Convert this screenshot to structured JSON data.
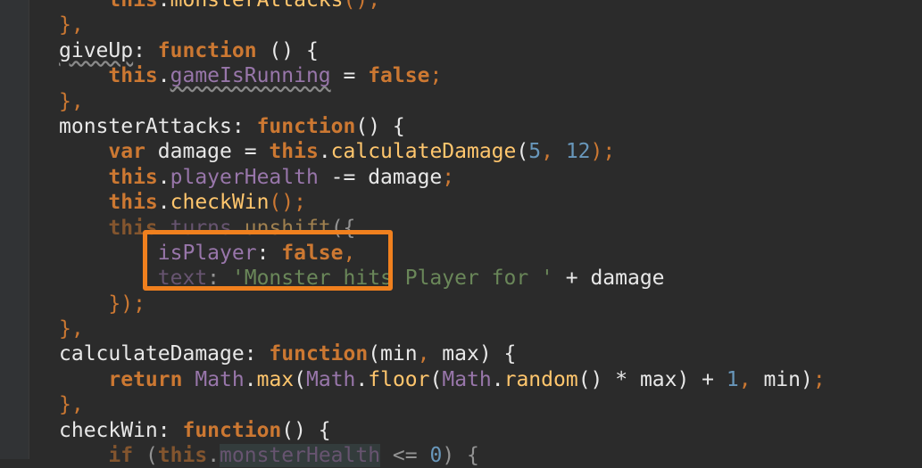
{
  "editor": {
    "lines": [
      [
        {
          "t": "    "
        },
        {
          "t": "this",
          "c": "this"
        },
        {
          "t": "."
        },
        {
          "t": "monsterAttacks",
          "c": "fn"
        },
        {
          "t": "();",
          "c": "punc"
        }
      ],
      [
        {
          "t": "},",
          "c": "punc"
        }
      ],
      [
        {
          "t": "giveUp",
          "c": "squig"
        },
        {
          "t": ": "
        },
        {
          "t": "function",
          "c": "kw"
        },
        {
          "t": " () {"
        }
      ],
      [
        {
          "t": "    "
        },
        {
          "t": "this",
          "c": "this"
        },
        {
          "t": "."
        },
        {
          "t": "gameIsRunning",
          "c": "propsquig"
        },
        {
          "t": " = "
        },
        {
          "t": "false",
          "c": "kw"
        },
        {
          "t": ";",
          "c": "punc"
        }
      ],
      [
        {
          "t": "},",
          "c": "punc"
        }
      ],
      [
        {
          "t": "monsterAttacks"
        },
        {
          "t": ": "
        },
        {
          "t": "function",
          "c": "kw"
        },
        {
          "t": "() {"
        }
      ],
      [
        {
          "t": "    "
        },
        {
          "t": "var",
          "c": "kw"
        },
        {
          "t": " damage = "
        },
        {
          "t": "this",
          "c": "this"
        },
        {
          "t": "."
        },
        {
          "t": "calculateDamage",
          "c": "fn"
        },
        {
          "t": "("
        },
        {
          "t": "5",
          "c": "num"
        },
        {
          "t": ", ",
          "c": "punc"
        },
        {
          "t": "12",
          "c": "num"
        },
        {
          "t": ");",
          "c": "punc"
        }
      ],
      [
        {
          "t": "    "
        },
        {
          "t": "this",
          "c": "this"
        },
        {
          "t": "."
        },
        {
          "t": "playerHealth",
          "c": "prop"
        },
        {
          "t": " -= damage"
        },
        {
          "t": ";",
          "c": "punc"
        }
      ],
      [
        {
          "t": "    "
        },
        {
          "t": "this",
          "c": "this"
        },
        {
          "t": "."
        },
        {
          "t": "checkWin",
          "c": "fn"
        },
        {
          "t": "();",
          "c": "punc"
        }
      ],
      [
        {
          "t": "    "
        },
        {
          "t": "this",
          "c": "thisdim"
        },
        {
          "t": ".",
          "c": "dim"
        },
        {
          "t": "turns",
          "c": "propdim"
        },
        {
          "t": ".",
          "c": "dim"
        },
        {
          "t": "unshift",
          "c": "fndim"
        },
        {
          "t": "({",
          "c": "dim"
        }
      ],
      [
        {
          "t": "        "
        },
        {
          "t": "isPlayer",
          "c": "prop"
        },
        {
          "t": ": "
        },
        {
          "t": "false",
          "c": "kw"
        },
        {
          "t": ",",
          "c": "punc"
        }
      ],
      [
        {
          "t": "        "
        },
        {
          "t": "text",
          "c": "propdim"
        },
        {
          "t": ": ",
          "c": "dim"
        },
        {
          "t": "'Monster hits Player for '",
          "c": "str"
        },
        {
          "t": " + damage"
        }
      ],
      [
        {
          "t": "    "
        },
        {
          "t": "});",
          "c": "punc"
        }
      ],
      [
        {
          "t": "},",
          "c": "punc"
        }
      ],
      [
        {
          "t": "calculateDamage"
        },
        {
          "t": ": "
        },
        {
          "t": "function",
          "c": "kw"
        },
        {
          "t": "(min"
        },
        {
          "t": ", ",
          "c": "punc"
        },
        {
          "t": "max) {"
        }
      ],
      [
        {
          "t": "    "
        },
        {
          "t": "return",
          "c": "kw"
        },
        {
          "t": " "
        },
        {
          "t": "Math",
          "c": "cls"
        },
        {
          "t": "."
        },
        {
          "t": "max",
          "c": "fn"
        },
        {
          "t": "("
        },
        {
          "t": "Math",
          "c": "cls"
        },
        {
          "t": "."
        },
        {
          "t": "floor",
          "c": "fn"
        },
        {
          "t": "("
        },
        {
          "t": "Math",
          "c": "cls"
        },
        {
          "t": "."
        },
        {
          "t": "random",
          "c": "fn"
        },
        {
          "t": "() * max) + "
        },
        {
          "t": "1",
          "c": "num"
        },
        {
          "t": ", ",
          "c": "punc"
        },
        {
          "t": "min)"
        },
        {
          "t": ";",
          "c": "punc"
        }
      ],
      [
        {
          "t": "},",
          "c": "punc"
        }
      ],
      [
        {
          "t": "checkWin"
        },
        {
          "t": ": "
        },
        {
          "t": "function",
          "c": "kw"
        },
        {
          "t": "() {"
        }
      ],
      [
        {
          "t": "    "
        },
        {
          "t": "if",
          "c": "kwdim"
        },
        {
          "t": " (",
          "c": "dim"
        },
        {
          "t": "this",
          "c": "thisdim"
        },
        {
          "t": ".",
          "c": "dim"
        },
        {
          "t": "monsterHealth",
          "c": "prophl"
        },
        {
          "t": " <= ",
          "c": "dim"
        },
        {
          "t": "0",
          "c": "num"
        },
        {
          "t": ") {",
          "c": "dim"
        }
      ]
    ]
  },
  "colors": {
    "background": "#2b2b2b",
    "highlight_box": "#f0801e"
  }
}
